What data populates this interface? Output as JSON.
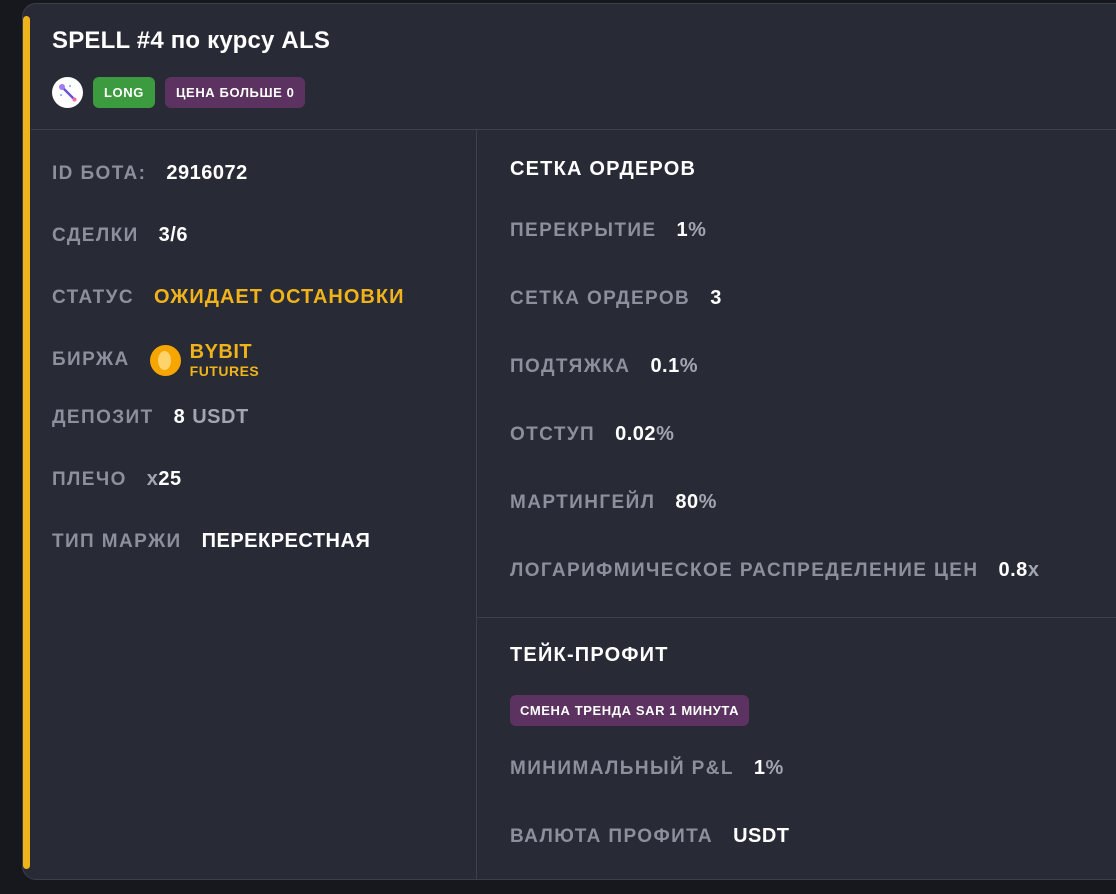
{
  "bot": {
    "title": "SPELL #4 по курсу ALS",
    "coin_icon": "spell-wand-icon",
    "badges": {
      "direction": "LONG",
      "condition": "ЦЕНА БОЛЬШЕ 0"
    }
  },
  "info": {
    "id_label": "ID БОТА:",
    "id_value": "2916072",
    "deals_label": "СДЕЛКИ",
    "deals_value": "3/6",
    "status_label": "СТАТУС",
    "status_value": "ОЖИДАЕТ ОСТАНОВКИ",
    "exchange_label": "БИРЖА",
    "exchange_name": "BYBIT",
    "exchange_sub": "FUTURES",
    "exchange_icon": "bybit-coin-icon",
    "deposit_label": "ДЕПОЗИТ",
    "deposit_value": "8",
    "deposit_unit": "USDT",
    "leverage_label": "ПЛЕЧО",
    "leverage_prefix": "x",
    "leverage_value": "25",
    "margin_label": "ТИП МАРЖИ",
    "margin_value": "ПЕРЕКРЕСТНАЯ"
  },
  "grid": {
    "title": "СЕТКА ОРДЕРОВ",
    "overlap_label": "ПЕРЕКРЫТИЕ",
    "overlap_value": "1",
    "overlap_unit": "%",
    "orders_label": "СЕТКА ОРДЕРОВ",
    "orders_value": "3",
    "pullup_label": "ПОДТЯЖКА",
    "pullup_value": "0.1",
    "pullup_unit": "%",
    "indent_label": "ОТСТУП",
    "indent_value": "0.02",
    "indent_unit": "%",
    "martingale_label": "МАРТИНГЕЙЛ",
    "martingale_value": "80",
    "martingale_unit": "%",
    "log_label": "ЛОГАРИФМИЧЕСКОЕ РАСПРЕДЕЛЕНИЕ ЦЕН",
    "log_value": "0.8",
    "log_unit": "x"
  },
  "take_profit": {
    "title": "ТЕЙК-ПРОФИТ",
    "badge": "СМЕНА ТРЕНДА SAR 1 МИНУТА",
    "min_pnl_label": "МИНИМАЛЬНЫЙ P&L",
    "min_pnl_value": "1",
    "min_pnl_unit": "%",
    "currency_label": "ВАЛЮТА ПРОФИТА",
    "currency_value": "USDT"
  },
  "colors": {
    "accent": "#f0b319",
    "long": "#3d9b3f",
    "condition": "#5b3260",
    "card_bg": "#282a36"
  }
}
